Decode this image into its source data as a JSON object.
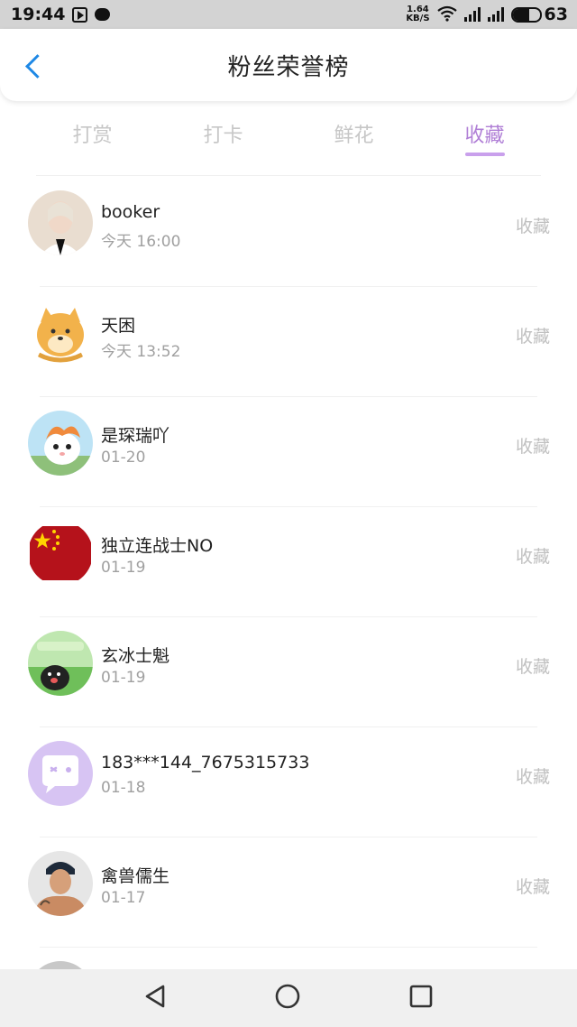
{
  "status_bar": {
    "time": "19:44",
    "speed_value": "1.64",
    "speed_unit": "KB/S",
    "battery": "63",
    "battery_level": 0.63,
    "icons": [
      "play-store-icon",
      "chat-bubble-icon",
      "wifi-icon",
      "signal-icon",
      "signal-icon",
      "battery-icon"
    ]
  },
  "header": {
    "title": "粉丝荣誉榜",
    "back_icon": "chevron-left-icon"
  },
  "tabs": [
    {
      "label": "打赏",
      "active": false
    },
    {
      "label": "打卡",
      "active": false
    },
    {
      "label": "鲜花",
      "active": false
    },
    {
      "label": "收藏",
      "active": true
    }
  ],
  "fans": [
    {
      "name": "booker",
      "time": "今天 16:00",
      "action": "收藏"
    },
    {
      "name": "天困",
      "time": "今天 13:52",
      "action": "收藏"
    },
    {
      "name": "是琛瑞吖",
      "time": "01-20",
      "action": "收藏"
    },
    {
      "name": "独立连战士NO",
      "time": "01-19",
      "action": "收藏"
    },
    {
      "name": "玄冰士魁",
      "time": "01-19",
      "action": "收藏"
    },
    {
      "name": "183***144_7675315733",
      "time": "01-18",
      "action": "收藏"
    },
    {
      "name": "禽兽儒生",
      "time": "01-17",
      "action": "收藏"
    }
  ],
  "colors": {
    "accent": "#b07fd6",
    "tab_indicator": "#c9a0ec",
    "back_arrow": "#1e88e5",
    "inactive_tab": "#c7c7c7"
  },
  "nav_bar": [
    "back-triangle-icon",
    "home-circle-icon",
    "recent-square-icon"
  ]
}
